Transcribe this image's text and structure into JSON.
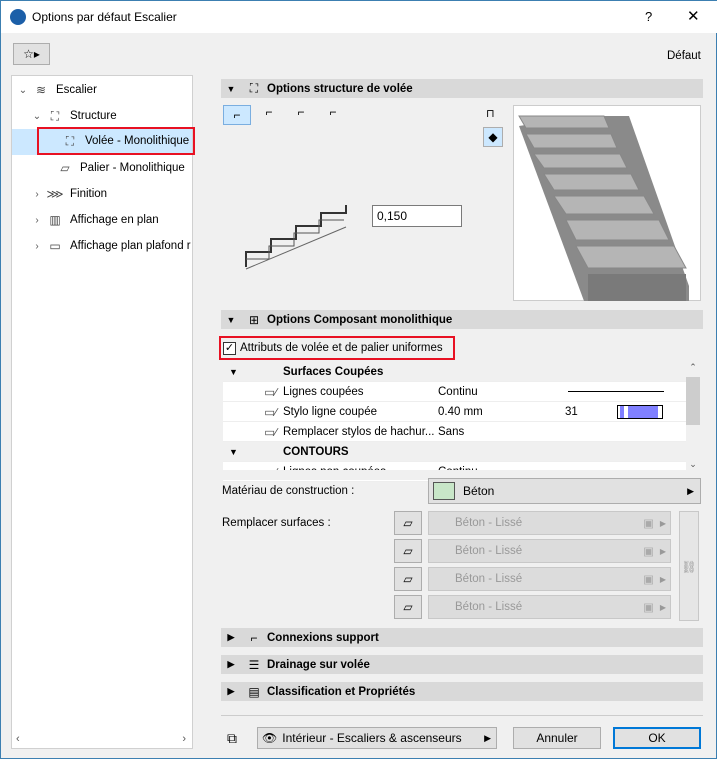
{
  "window": {
    "title": "Options par défaut Escalier",
    "help": "?",
    "close": "✕"
  },
  "toolbar": {
    "preset": "Défaut"
  },
  "tree": [
    {
      "label": "Escalier",
      "chev": "⌄",
      "icon": "≋"
    },
    {
      "label": "Structure",
      "chev": "⌄",
      "icon": "⛶"
    },
    {
      "label": "Volée - Monolithique",
      "chev": "",
      "icon": "⛶"
    },
    {
      "label": "Palier - Monolithique",
      "chev": "",
      "icon": "▱"
    },
    {
      "label": "Finition",
      "chev": "›",
      "icon": "⋙"
    },
    {
      "label": "Affichage en plan",
      "chev": "›",
      "icon": "▥"
    },
    {
      "label": "Affichage plan plafond r",
      "chev": "›",
      "icon": "▭"
    }
  ],
  "sections": {
    "structure": "Options structure de volée",
    "composant": "Options Composant monolithique",
    "connexions": "Connexions support",
    "drainage": "Drainage sur volée",
    "classification": "Classification et Propriétés"
  },
  "riser_value": "0,150",
  "uniform_checkbox": {
    "label": "Attributs de volée et de palier uniformes",
    "checked": true
  },
  "table": {
    "groups": [
      {
        "title": "Surfaces Coupées",
        "rows": [
          {
            "label": "Lignes coupées",
            "value": "Continu",
            "extra": ""
          },
          {
            "label": "Stylo ligne coupée",
            "value": "0.40 mm",
            "extra": "31"
          },
          {
            "label": "Remplacer stylos de hachur...",
            "value": "Sans",
            "extra": ""
          }
        ]
      },
      {
        "title": "CONTOURS",
        "rows": [
          {
            "label": "Lignes non coupées",
            "value": "Continu",
            "extra": ""
          }
        ]
      }
    ]
  },
  "material": {
    "label": "Matériau de construction :",
    "value": "Béton"
  },
  "surfaces": {
    "label": "Remplacer surfaces :",
    "items": [
      "Béton - Lissé",
      "Béton - Lissé",
      "Béton - Lissé",
      "Béton - Lissé"
    ]
  },
  "footer": {
    "layer": "Intérieur - Escaliers & ascenseurs",
    "cancel": "Annuler",
    "ok": "OK"
  },
  "colors": {
    "highlight": "#cce8ff",
    "red": "#e81123",
    "pen": "#8080ff"
  }
}
